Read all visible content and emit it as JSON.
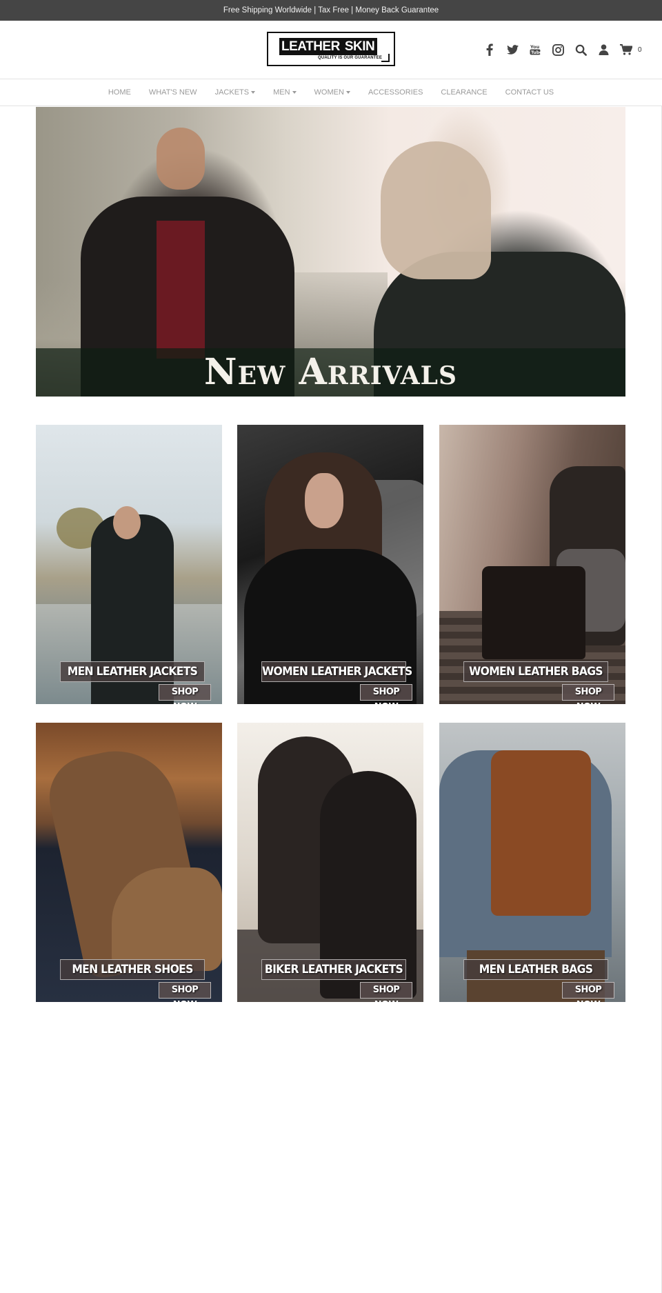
{
  "topbar": {
    "text": "Free Shipping Worldwide | Tax Free | Money Back Guarantee"
  },
  "header": {
    "logo": {
      "part1": "LEATHER",
      "part2": "SKIN",
      "tagline": "QUALITY IS OUR GUARANTEE"
    },
    "icons": [
      "facebook-icon",
      "twitter-icon",
      "youtube-icon",
      "instagram-icon",
      "search-icon",
      "user-icon",
      "cart-icon"
    ],
    "cart_count": "0"
  },
  "nav": {
    "items": [
      {
        "label": "HOME"
      },
      {
        "label": "WHAT'S NEW"
      },
      {
        "label": "JACKETS"
      },
      {
        "label": "MEN"
      },
      {
        "label": "WOMEN"
      },
      {
        "label": "ACCESSORIES"
      },
      {
        "label": "CLEARANCE"
      },
      {
        "label": "CONTACT US"
      }
    ]
  },
  "hero": {
    "title": "New Arrivals"
  },
  "tiles": [
    {
      "label": "MEN LEATHER JACKETS",
      "button": "SHOP NOW"
    },
    {
      "label": "WOMEN LEATHER JACKETS",
      "button": "SHOP NOW"
    },
    {
      "label": "WOMEN LEATHER BAGS",
      "button": "SHOP NOW"
    },
    {
      "label": "MEN LEATHER SHOES",
      "button": "SHOP NOW"
    },
    {
      "label": "BIKER LEATHER JACKETS",
      "button": "SHOP NOW"
    },
    {
      "label": "MEN LEATHER BAGS",
      "button": "SHOP NOW"
    }
  ],
  "colors": {
    "topbar_bg": "#454545",
    "nav_text": "#9a9a9a",
    "label_box": "#463c3c"
  }
}
